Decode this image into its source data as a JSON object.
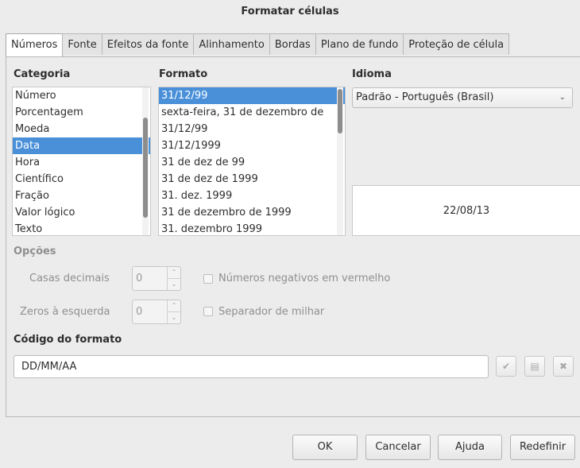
{
  "window": {
    "title": "Formatar células"
  },
  "tabs": [
    {
      "label": "Números",
      "active": true
    },
    {
      "label": "Fonte"
    },
    {
      "label": "Efeitos da fonte"
    },
    {
      "label": "Alinhamento"
    },
    {
      "label": "Bordas"
    },
    {
      "label": "Plano de fundo"
    },
    {
      "label": "Proteção de célula"
    }
  ],
  "category": {
    "heading": "Categoria",
    "items": [
      "Número",
      "Porcentagem",
      "Moeda",
      "Data",
      "Hora",
      "Científico",
      "Fração",
      "Valor lógico",
      "Texto"
    ],
    "selected_index": 3
  },
  "format": {
    "heading": "Formato",
    "items": [
      "31/12/99",
      "sexta-feira, 31 de dezembro de",
      "31/12/99",
      "31/12/1999",
      "31 de dez de 99",
      "31 de dez de 1999",
      "31. dez. 1999",
      "31 de dezembro de 1999",
      "31. dezembro 1999"
    ],
    "selected_index": 0
  },
  "language": {
    "heading": "Idioma",
    "selected": "Padrão - Português (Brasil)",
    "preview": "22/08/13"
  },
  "options": {
    "heading": "Opções",
    "decimal_label": "Casas decimais",
    "decimal_value": "0",
    "leading_zeros_label": "Zeros à esquerda",
    "leading_zeros_value": "0",
    "negative_red_label": "Números negativos em vermelho",
    "negative_red_checked": false,
    "thousands_sep_label": "Separador de milhar",
    "thousands_sep_checked": false
  },
  "format_code": {
    "heading": "Código do formato",
    "value": "DD/MM/AA"
  },
  "buttons": {
    "ok": "OK",
    "cancel": "Cancelar",
    "help": "Ajuda",
    "reset": "Redefinir"
  },
  "colors": {
    "selection": "#4a90d9"
  }
}
